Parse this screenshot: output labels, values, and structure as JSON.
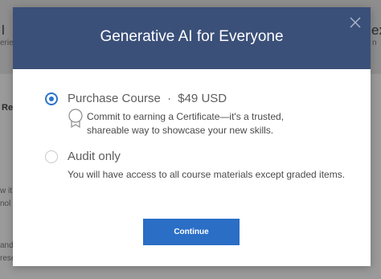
{
  "background": {
    "header_left": "l",
    "header_left_sub": "erie",
    "header_right": "exib",
    "header_right_sub": "n",
    "left_tab": "Rec",
    "left_text_1": "w it",
    "left_text_2": "nol",
    "left_text_3": "and",
    "left_text_4": "rese"
  },
  "modal": {
    "title": "Generative AI for Everyone",
    "close_icon": "close-icon",
    "options": [
      {
        "label": "Purchase Course",
        "separator": "·",
        "price": "$49 USD",
        "selected": true,
        "description": "Commit to earning a Certificate—it's a trusted, shareable way to showcase your new skills."
      },
      {
        "label": "Audit only",
        "selected": false,
        "description": "You will have access to all course materials except graded items."
      }
    ],
    "continue_label": "Continue"
  },
  "colors": {
    "header_bg": "#3b5079",
    "accent": "#2a73cc",
    "button": "#2a6ec6",
    "overlay": "#9a9a9a"
  }
}
